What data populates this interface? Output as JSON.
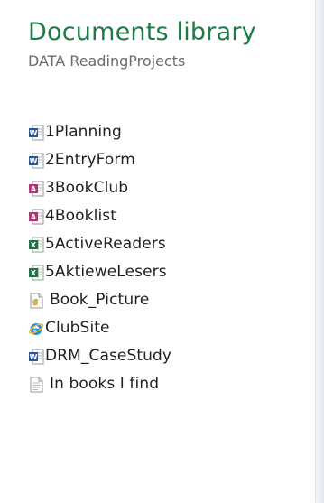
{
  "library": {
    "title": "Documents library",
    "subtitle": "DATA ReadingProjects"
  },
  "files": [
    {
      "name": "1Planning",
      "icon": "word-document-icon"
    },
    {
      "name": "2EntryForm",
      "icon": "word-document-icon"
    },
    {
      "name": "3BookClub",
      "icon": "pdf-document-icon"
    },
    {
      "name": "4Booklist",
      "icon": "pdf-document-icon"
    },
    {
      "name": "5ActiveReaders",
      "icon": "excel-spreadsheet-icon"
    },
    {
      "name": "5AktieweLesers",
      "icon": "excel-spreadsheet-icon"
    },
    {
      "name": "Book_Picture",
      "icon": "image-file-icon"
    },
    {
      "name": "ClubSite",
      "icon": "internet-explorer-icon"
    },
    {
      "name": "DRM_CaseStudy",
      "icon": "word-document-icon"
    },
    {
      "name": "In books I find",
      "icon": "text-document-icon"
    }
  ],
  "colors": {
    "title": "#1e7b45",
    "subtitle": "#6b6b6b",
    "word": "#2b5797",
    "pdf": "#b8327a",
    "excel": "#217346",
    "ie": "#1f8fe0"
  }
}
